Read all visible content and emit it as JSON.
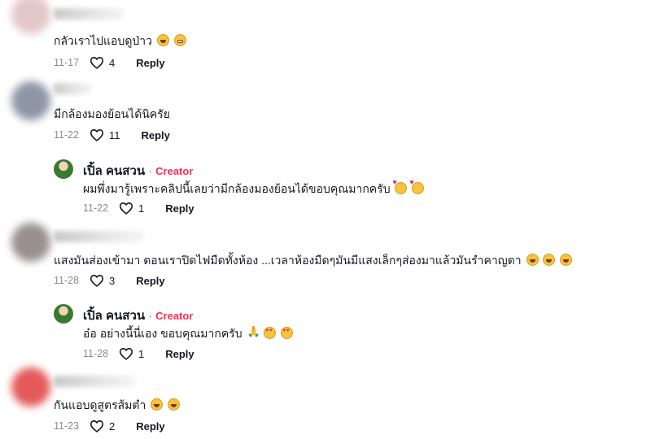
{
  "comments": [
    {
      "text": "กลัวเราไปแอบดูป่าว",
      "emojis": [
        "laugh",
        "grin"
      ],
      "date": "11-17",
      "likes": "4",
      "reply_label": "Reply",
      "avatar_color": "#e2c8c8"
    },
    {
      "text": "มีกล้องมองย้อนได้นิครัย",
      "emojis": [],
      "date": "11-22",
      "likes": "11",
      "reply_label": "Reply",
      "avatar_color": "#8e96a6",
      "replies": [
        {
          "author": "เปิ้ล คนสวน",
          "separator": "·",
          "badge": "Creator",
          "text": "ผมพึ่งมารู้เพราะคลิปนี้เลยว่ามีกล้องมองย้อนได้ขอบคุณมากครับ",
          "emojis": [
            "hearts",
            "hearts"
          ],
          "date": "11-22",
          "likes": "1",
          "reply_label": "Reply"
        }
      ]
    },
    {
      "text": "แสงมันส่องเข้ามา ตอนเราปิดไฟมืดทั้งห้อง ...เวลาห้องมืดๆมันมีแสงเล็กๆส่องมาแล้วมันรำคาญตา",
      "emojis": [
        "laugh",
        "laugh",
        "laugh"
      ],
      "date": "11-28",
      "likes": "3",
      "reply_label": "Reply",
      "avatar_color": "#9a8f8f",
      "replies": [
        {
          "author": "เปิ้ล คนสวน",
          "separator": "·",
          "badge": "Creator",
          "text": "อ๋อ อย่างนี้นี่เอง ขอบคุณมากครับ",
          "emojis": [
            "pray",
            "hearteyes",
            "hearteyes"
          ],
          "date": "11-28",
          "likes": "1",
          "reply_label": "Reply"
        }
      ]
    },
    {
      "text": "กันแอบดูสูตรส้มตำ",
      "emojis": [
        "laugh",
        "laugh"
      ],
      "date": "11-23",
      "likes": "2",
      "reply_label": "Reply",
      "avatar_color": "#e45a5a"
    }
  ]
}
